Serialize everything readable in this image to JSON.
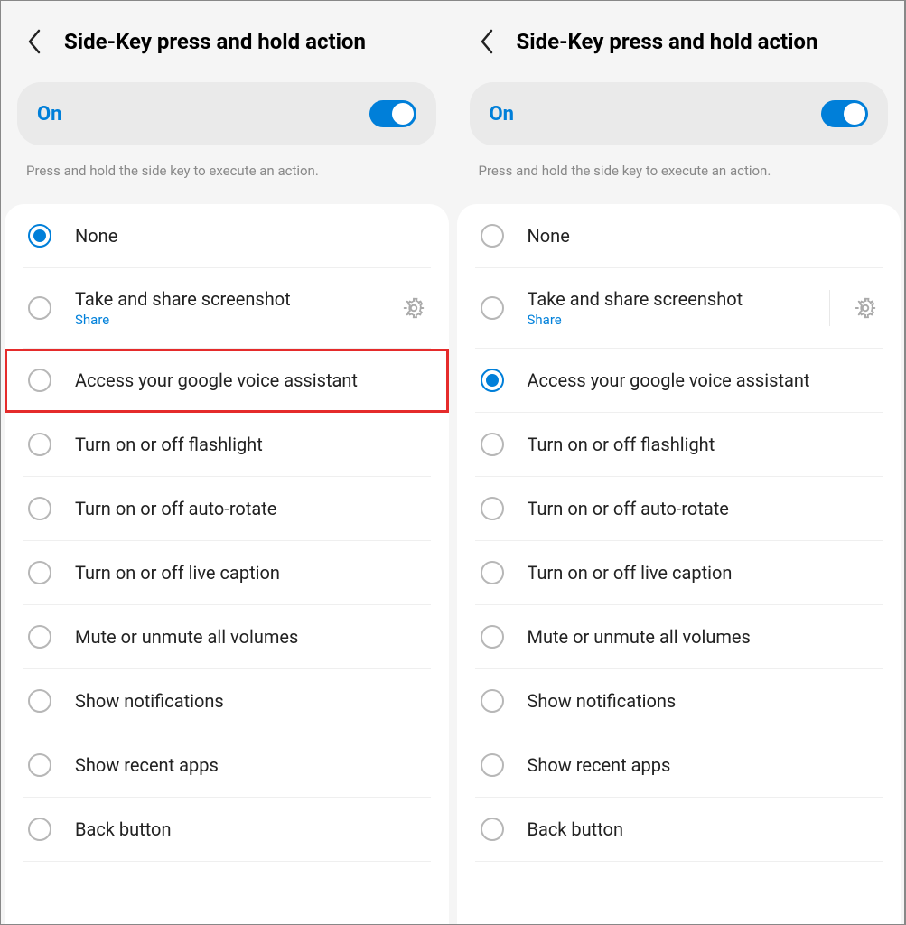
{
  "panes": [
    {
      "title": "Side-Key press and hold action",
      "toggleLabel": "On",
      "description": "Press and hold the side key to execute an action.",
      "selectedIndex": 0,
      "highlightIndex": 2,
      "options": [
        {
          "label": "None"
        },
        {
          "label": "Take and share screenshot",
          "sub": "Share",
          "gear": true
        },
        {
          "label": "Access your google voice assistant"
        },
        {
          "label": "Turn on or off flashlight"
        },
        {
          "label": "Turn on or off auto-rotate"
        },
        {
          "label": "Turn on or off live caption"
        },
        {
          "label": "Mute or unmute all volumes"
        },
        {
          "label": "Show notifications"
        },
        {
          "label": "Show recent apps"
        },
        {
          "label": "Back button"
        }
      ]
    },
    {
      "title": "Side-Key press and hold action",
      "toggleLabel": "On",
      "description": "Press and hold the side key to execute an action.",
      "selectedIndex": 2,
      "highlightIndex": -1,
      "options": [
        {
          "label": "None"
        },
        {
          "label": "Take and share screenshot",
          "sub": "Share",
          "gear": true
        },
        {
          "label": "Access your google voice assistant"
        },
        {
          "label": "Turn on or off flashlight"
        },
        {
          "label": "Turn on or off auto-rotate"
        },
        {
          "label": "Turn on or off live caption"
        },
        {
          "label": "Mute or unmute all volumes"
        },
        {
          "label": "Show notifications"
        },
        {
          "label": "Show recent apps"
        },
        {
          "label": "Back button"
        }
      ]
    }
  ]
}
